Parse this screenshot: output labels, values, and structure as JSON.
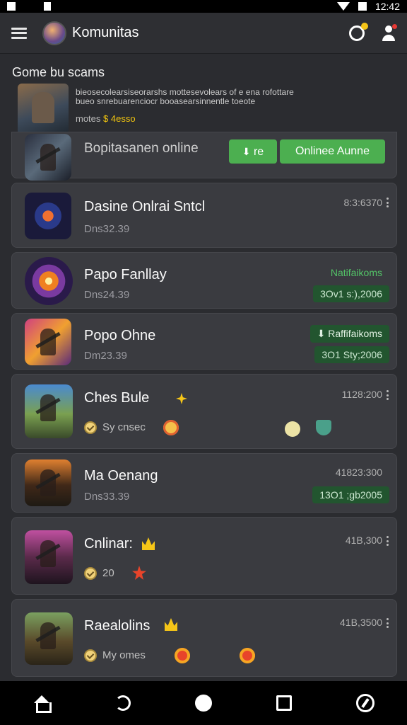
{
  "app_bar": {
    "title": "Komunitas"
  },
  "section": {
    "header": "Gome bu scams"
  },
  "promo": {
    "text_line1": "bieosecolearsiseorarshs mottesevolears of e ena rofottare",
    "text_line2": "bueo snrebuarenciocr booasearsinnentle toeote",
    "footer_prefix": "motes",
    "footer_gold": "$ 4esso"
  },
  "top_card": {
    "title": "Bopitasanen online",
    "button_small": "re",
    "button_main": "Onlinee Aunne"
  },
  "cards": [
    {
      "title": "Dasine Onlrai Sntcl",
      "sub": "Dns32.39",
      "meta": "8:3:6370"
    },
    {
      "title": "Papo Fanllay",
      "sub": "Dns24.39",
      "pill_light": "Natifaikoms",
      "pill_dark": "3Ov1 s:),2006"
    },
    {
      "title": "Popo Ohne",
      "sub": "Dm23.39",
      "pill_light": "Raffifaikoms",
      "pill_dark": "3O1 Sty;2006"
    },
    {
      "title": "Ches Bule",
      "meta": "1128:200",
      "text": "Sy cnsec"
    },
    {
      "title": "Ma Oenang",
      "sub": "Dns33.39",
      "meta": "41823:300",
      "pill_dark": "13O1 ;gb2005"
    },
    {
      "title": "Cnlinar:",
      "meta": "41B,300",
      "text": "20"
    },
    {
      "title": "Raealolins",
      "meta": "41B,3500",
      "text": "My omes"
    }
  ],
  "colors": {
    "accent": "#4caf50",
    "background": "#2b2c30",
    "card": "#3a3b40"
  }
}
